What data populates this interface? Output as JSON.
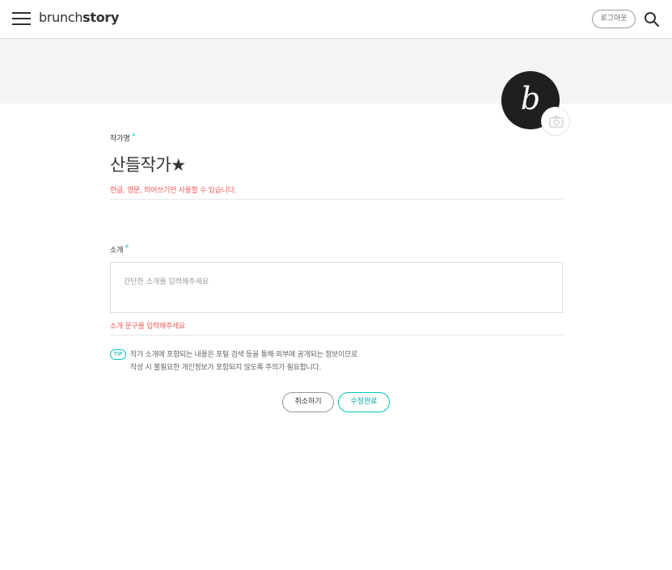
{
  "header": {
    "logo_part1": "brunch",
    "logo_part2": "story",
    "logout_label": "로그아웃"
  },
  "profile": {
    "avatar_glyph": "b"
  },
  "author_field": {
    "label": "작가명",
    "required_mark": "*",
    "value": "산들작가★",
    "hint": "한글, 영문, 띄어쓰기만 사용할 수 있습니다."
  },
  "intro_field": {
    "label": "소개",
    "required_mark": "*",
    "placeholder": "간단한 소개를 입력해주세요",
    "error": "소개 문구를 입력해주세요"
  },
  "tip": {
    "badge": "TIP",
    "line1": "작가 소개에 포함되는 내용은 포털 검색 등을 통해 외부에 공개되는 정보이므로",
    "line2": "작성 시 불필요한 개인정보가 포함되지 않도록 주의가 필요합니다."
  },
  "actions": {
    "cancel_label": "취소하기",
    "submit_label": "수정완료"
  },
  "colors": {
    "accent": "#00c6be",
    "error": "#ef5a5a",
    "cover": "#f4f4f4",
    "avatar_bg": "#1f1f1f"
  }
}
